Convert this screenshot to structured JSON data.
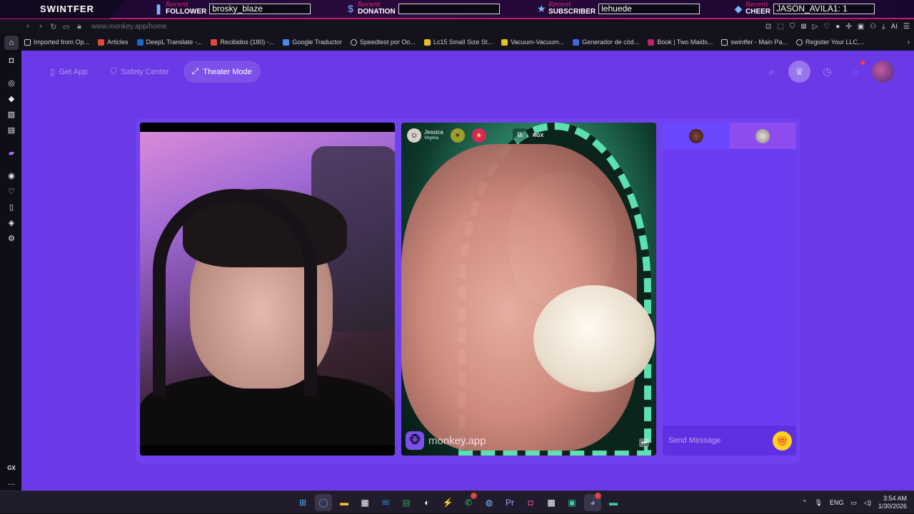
{
  "overlay": {
    "brand": "SWINTFER",
    "recent_label": "Recent",
    "items": [
      {
        "type": "FOLLOWER",
        "value": "brosky_blaze",
        "icon": "flame"
      },
      {
        "type": "DONATION",
        "value": "",
        "icon": "dollar"
      },
      {
        "type": "SUBSCRIBER",
        "value": "lehuede",
        "icon": "star"
      },
      {
        "type": "CHEER",
        "value": "JASON_AVILA1: 1",
        "icon": "drop"
      }
    ]
  },
  "browser": {
    "url_host": "www.monkey.app",
    "url_path": "/home",
    "ai_label": "AI",
    "bookmarks": [
      {
        "label": "Imported from Op...",
        "color": "#d0d0da"
      },
      {
        "label": "Articles",
        "color": "#e04a3c"
      },
      {
        "label": "DeepL Translate -...",
        "color": "#1a6ad0"
      },
      {
        "label": "Recibidos (180) -...",
        "color": "#e04a3c"
      },
      {
        "label": "Google Traductor",
        "color": "#4a8af0"
      },
      {
        "label": "Speedtest por Oo...",
        "color": "#d0d0da"
      },
      {
        "label": "Lc15 Small Size St...",
        "color": "#e8c020"
      },
      {
        "label": "Vacuum-Vacuum...",
        "color": "#e8c020"
      },
      {
        "label": "Generador de cód...",
        "color": "#3a6ae0"
      },
      {
        "label": "Book | Two Maids...",
        "color": "#c02070"
      },
      {
        "label": "swintfer - Main Pa...",
        "color": "#d0d0da"
      },
      {
        "label": "Register Your LLC,...",
        "color": "#d0d0da"
      }
    ],
    "sidebar_label": "GX"
  },
  "page": {
    "nav": {
      "get_app": "Get App",
      "safety_center": "Safety Center",
      "theater_mode": "Theater Mode"
    },
    "notification_count": 1,
    "remote_user": {
      "name": "Jessica",
      "location": "Virginia"
    },
    "video_tag": "RGX",
    "watermark": "monkey.app",
    "chat": {
      "placeholder": "Send Message"
    }
  },
  "taskbar": {
    "language": "ENG",
    "time": "3:54 AM",
    "date": "1/30/2026",
    "whatsapp_badge": "1",
    "discord_badge": "1"
  },
  "colors": {
    "page_bg": "#6a3ae6",
    "overlay_accent": "#c8147a",
    "gift": "#ffd21e"
  }
}
